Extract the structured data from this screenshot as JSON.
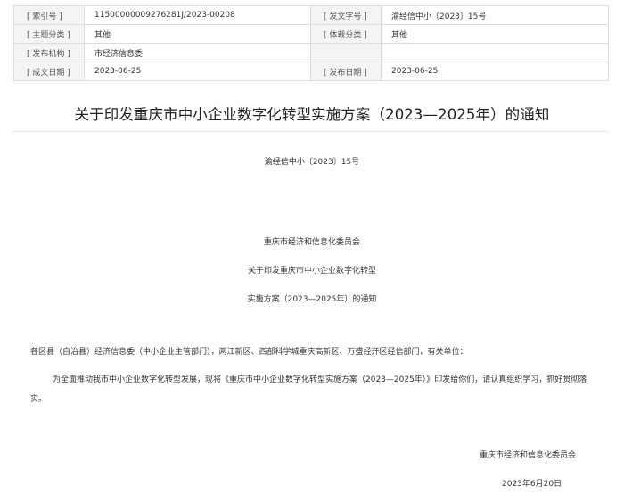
{
  "meta": {
    "index_label": "[ 索引号 ]",
    "index_value": "11500000009276281J/2023-00208",
    "doc_no_label": "[ 发文字号 ]",
    "doc_no_value": "渝经信中小〔2023〕15号",
    "subject_label": "[ 主题分类 ]",
    "subject_value": "其他",
    "genre_label": "[ 体裁分类 ]",
    "genre_value": "其他",
    "issuer_label": "[ 发布机构 ]",
    "issuer_value": "市经济信息委",
    "created_label": "[ 成文日期 ]",
    "created_value": "2023-06-25",
    "published_label": "[ 发布日期 ]",
    "published_value": "2023-06-25"
  },
  "doc": {
    "title": "关于印发重庆市中小企业数字化转型实施方案（2023—2025年）的通知",
    "doc_number": "渝经信中小〔2023〕15号",
    "issuer": "重庆市经济和信息化委员会",
    "subtitle_line1": "关于印发重庆市中小企业数字化转型",
    "subtitle_line2": "实施方案（2023—2025年）的通知",
    "recipients": "各区县（自治县）经济信息委（中小企业主管部门），两江新区、西部科学城重庆高新区、万盛经开区经信部门，有关单位：",
    "body": "为全面推动我市中小企业数字化转型发展，现将《重庆市中小企业数字化转型实施方案（2023—2025年）》印发给你们，请认真组织学习，抓好贯彻落实。",
    "signature": "重庆市经济和信息化委员会",
    "sign_date": "2023年6月20日"
  }
}
